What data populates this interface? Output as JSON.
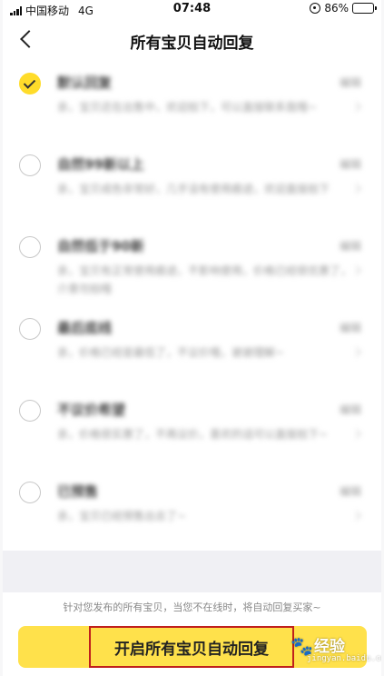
{
  "status_bar": {
    "carrier": "中国移动",
    "network": "4G",
    "time": "07:48",
    "battery": "86%",
    "battery_level": 0.86
  },
  "nav": {
    "title": "所有宝贝自动回复"
  },
  "reply_options": [
    {
      "title": "默认回复",
      "edit": "编辑",
      "text": "亲，宝贝还在出售中，欢迎拍下，可以直接联系我哦~",
      "checked": true
    },
    {
      "title": "自然99新以上",
      "edit": "编辑",
      "text": "亲，宝贝成色非常好，几乎没有使用痕迹，欢迎直接拍下",
      "checked": false
    },
    {
      "title": "自然低于90新",
      "edit": "编辑",
      "text": "亲，宝贝有正常使用痕迹，不影响使用，价格已经很优惠了，介意勿拍哦",
      "checked": false
    },
    {
      "title": "最后底线",
      "edit": "编辑",
      "text": "亲，价格已经是最低了，不议价哦，谢谢理解~",
      "checked": false
    },
    {
      "title": "不议价希望",
      "edit": "编辑",
      "text": "亲，价格很实惠了，不再议价，喜欢的话可以直接拍下~",
      "checked": false
    },
    {
      "title": "已预售",
      "edit": "编辑",
      "text": "亲，宝贝已经预售出去了~",
      "checked": false
    }
  ],
  "footer": {
    "note": "针对您发布的所有宝贝，当您不在线时，将自动回复买家~",
    "button_label": "开启所有宝贝自动回复"
  },
  "watermark": {
    "text": "经验",
    "sub": "jingyan.baidu.com"
  },
  "colors": {
    "accent": "#ffdc2a",
    "highlight_border": "#c0201c"
  }
}
